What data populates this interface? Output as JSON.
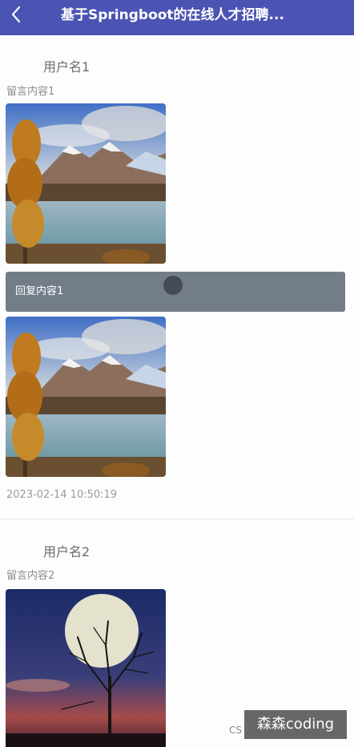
{
  "header": {
    "title": "基于Springboot的在线人才招聘..."
  },
  "messages": [
    {
      "username": "用户名1",
      "content": "留言内容1",
      "reply": "回复内容1",
      "time": "2023-02-14 10:50:19"
    },
    {
      "username": "用户名2",
      "content": "留言内容2"
    }
  ],
  "watermark": {
    "text": "森森coding",
    "fragment": "CS"
  },
  "colors": {
    "header_bg": "#4b53b3",
    "reply_bg": "#737d8a"
  }
}
